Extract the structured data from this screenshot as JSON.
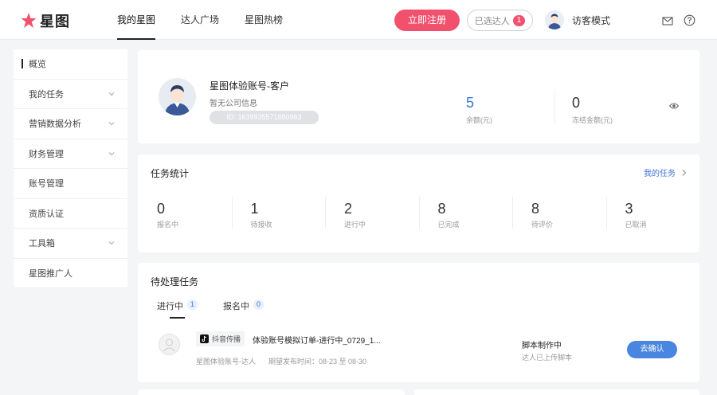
{
  "header": {
    "logo_text": "星图",
    "nav": [
      "我的星图",
      "达人广场",
      "星图热榜"
    ],
    "register_label": "立即注册",
    "selected_label": "已选达人",
    "selected_count": "1",
    "user_name": "访客模式"
  },
  "sidebar": {
    "items": [
      {
        "label": "概览"
      },
      {
        "label": "我的任务"
      },
      {
        "label": "营销数据分析"
      },
      {
        "label": "财务管理"
      },
      {
        "label": "账号管理"
      },
      {
        "label": "资质认证"
      },
      {
        "label": "工具箱"
      },
      {
        "label": "星图推广人"
      }
    ]
  },
  "profile": {
    "account_name": "星图体验账号-客户",
    "company": "暂无公司信息",
    "id_text": "ID: 1639935571880963",
    "balance_value": "5",
    "balance_label": "余额(元)",
    "frozen_value": "0",
    "frozen_label": "冻结金额(元)"
  },
  "stats": {
    "title": "任务统计",
    "link_label": "我的任务",
    "items": [
      {
        "value": "0",
        "label": "报名中"
      },
      {
        "value": "1",
        "label": "待接收"
      },
      {
        "value": "2",
        "label": "进行中"
      },
      {
        "value": "8",
        "label": "已完成"
      },
      {
        "value": "8",
        "label": "待评价"
      },
      {
        "value": "3",
        "label": "已取消"
      }
    ]
  },
  "pending": {
    "title": "待处理任务",
    "tabs": [
      {
        "label": "进行中",
        "count": "1"
      },
      {
        "label": "报名中",
        "count": "0"
      }
    ],
    "task": {
      "platform": "抖音传播",
      "name": "体验账号模拟订单-进行中_0729_1...",
      "owner": "星图体验账号-达人",
      "time": "期望发布时间：08-23 至 08-30",
      "status": "脚本制作中",
      "status_sub": "达人已上传脚本",
      "action": "去确认"
    }
  },
  "colors": {
    "accent": "#3a74d6",
    "brand": "#f2516e"
  }
}
